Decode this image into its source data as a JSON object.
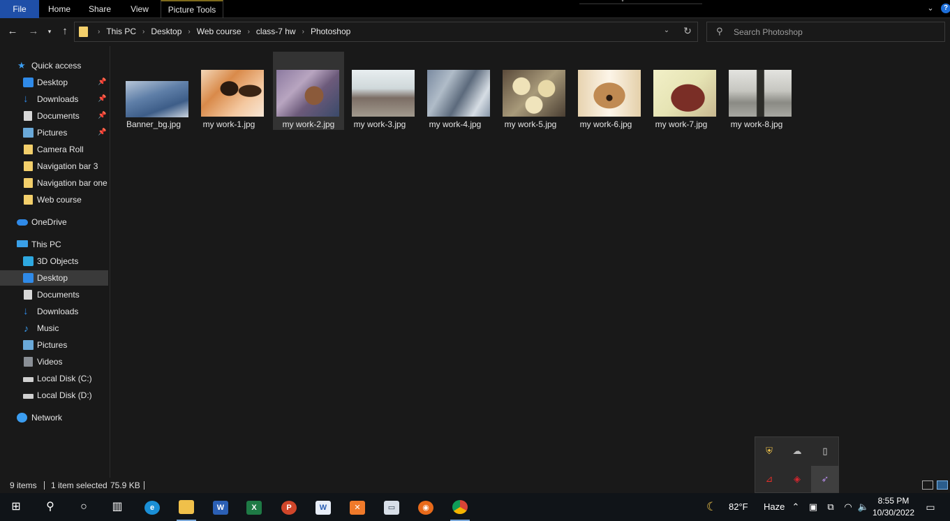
{
  "ribbon": {
    "tabs": [
      "File",
      "Home",
      "Share",
      "View"
    ],
    "context_tab": "Picture Tools"
  },
  "address": {
    "crumbs": [
      "This PC",
      "Desktop",
      "Web course",
      "class-7 hw",
      "Photoshop"
    ]
  },
  "search": {
    "placeholder": "Search Photoshop"
  },
  "nav": {
    "quick_access": "Quick access",
    "quick_items": [
      {
        "label": "Desktop",
        "icon": "desktop-icon",
        "pinned": true
      },
      {
        "label": "Downloads",
        "icon": "downloads-icon",
        "pinned": true
      },
      {
        "label": "Documents",
        "icon": "documents-icon",
        "pinned": true
      },
      {
        "label": "Pictures",
        "icon": "pictures-icon",
        "pinned": true
      },
      {
        "label": "Camera Roll",
        "icon": "folder-icon",
        "pinned": false
      },
      {
        "label": "Navigation bar 3",
        "icon": "folder-icon",
        "pinned": false
      },
      {
        "label": "Navigation bar one",
        "icon": "folder-icon",
        "pinned": false
      },
      {
        "label": "Web course",
        "icon": "folder-icon",
        "pinned": false
      }
    ],
    "onedrive": "OneDrive",
    "this_pc": "This PC",
    "pc_items": [
      {
        "label": "3D Objects",
        "icon": "3d-objects-icon"
      },
      {
        "label": "Desktop",
        "icon": "desktop-icon",
        "selected": true
      },
      {
        "label": "Documents",
        "icon": "documents-icon"
      },
      {
        "label": "Downloads",
        "icon": "downloads-icon"
      },
      {
        "label": "Music",
        "icon": "music-icon"
      },
      {
        "label": "Pictures",
        "icon": "pictures-icon"
      },
      {
        "label": "Videos",
        "icon": "videos-icon"
      },
      {
        "label": "Local Disk (C:)",
        "icon": "drive-icon"
      },
      {
        "label": "Local Disk (D:)",
        "icon": "drive-icon"
      }
    ],
    "network": "Network"
  },
  "files": [
    {
      "name": "Banner_bg.jpg",
      "selected": false
    },
    {
      "name": "my work-1.jpg",
      "selected": false
    },
    {
      "name": "my work-2.jpg",
      "selected": true
    },
    {
      "name": "my work-3.jpg",
      "selected": false
    },
    {
      "name": "my work-4.jpg",
      "selected": false
    },
    {
      "name": "my work-5.jpg",
      "selected": false
    },
    {
      "name": "my work-6.jpg",
      "selected": false
    },
    {
      "name": "my work-7.jpg",
      "selected": false
    },
    {
      "name": "my work-8.jpg",
      "selected": false
    }
  ],
  "status": {
    "count": "9 items",
    "selection": "1 item selected",
    "size": "75.9 KB"
  },
  "taskbar": {
    "apps": [
      "start-icon",
      "search-icon",
      "cortana-icon",
      "task-view-icon",
      "edge-icon",
      "file-explorer-icon",
      "word-icon",
      "excel-icon",
      "powerpoint-icon",
      "word-legacy-icon",
      "xampp-icon",
      "remote-desktop-icon",
      "firefox-icon",
      "chrome-icon"
    ],
    "weather_temp": "82°F",
    "weather_cond": "Haze",
    "time": "8:55 PM",
    "date": "10/30/2022"
  },
  "colors": {
    "accent_file_tab": "#1f4fa8",
    "background": "#191919",
    "selection": "#333333"
  }
}
